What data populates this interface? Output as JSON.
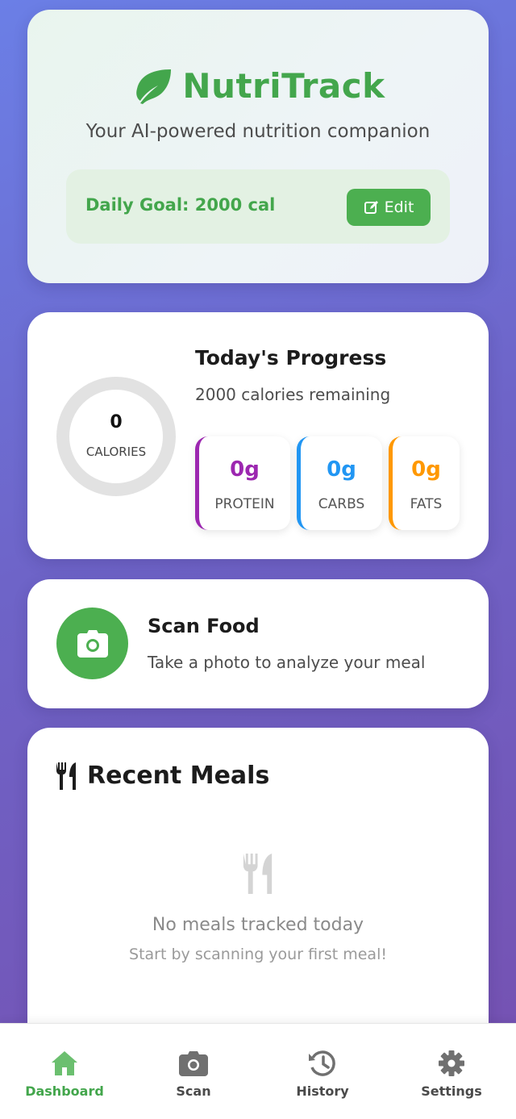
{
  "app": {
    "title": "NutriTrack",
    "tagline": "Your AI-powered nutrition companion",
    "brand_color": "#43a64c"
  },
  "goal": {
    "label": "Daily Goal: 2000 cal",
    "edit_label": "Edit"
  },
  "progress": {
    "title": "Today's Progress",
    "remaining": "2000 calories remaining",
    "calories_value": "0",
    "calories_label": "CALORIES",
    "calories_fraction": 0,
    "macros": [
      {
        "value": "0g",
        "label": "PROTEIN",
        "color": "#9c27b0"
      },
      {
        "value": "0g",
        "label": "CARBS",
        "color": "#2196f3"
      },
      {
        "value": "0g",
        "label": "FATS",
        "color": "#ff9800"
      }
    ]
  },
  "scan": {
    "title": "Scan Food",
    "subtitle": "Take a photo to analyze your meal",
    "icon": "camera-icon"
  },
  "meals": {
    "title": "Recent Meals",
    "empty_title": "No meals tracked today",
    "empty_subtitle": "Start by scanning your first meal!",
    "icon": "utensils-icon"
  },
  "nav": {
    "active": "dashboard",
    "items": [
      {
        "label": "Dashboard",
        "icon": "home-icon"
      },
      {
        "label": "Scan",
        "icon": "camera-icon"
      },
      {
        "label": "History",
        "icon": "history-icon"
      },
      {
        "label": "Settings",
        "icon": "gear-icon"
      }
    ]
  }
}
